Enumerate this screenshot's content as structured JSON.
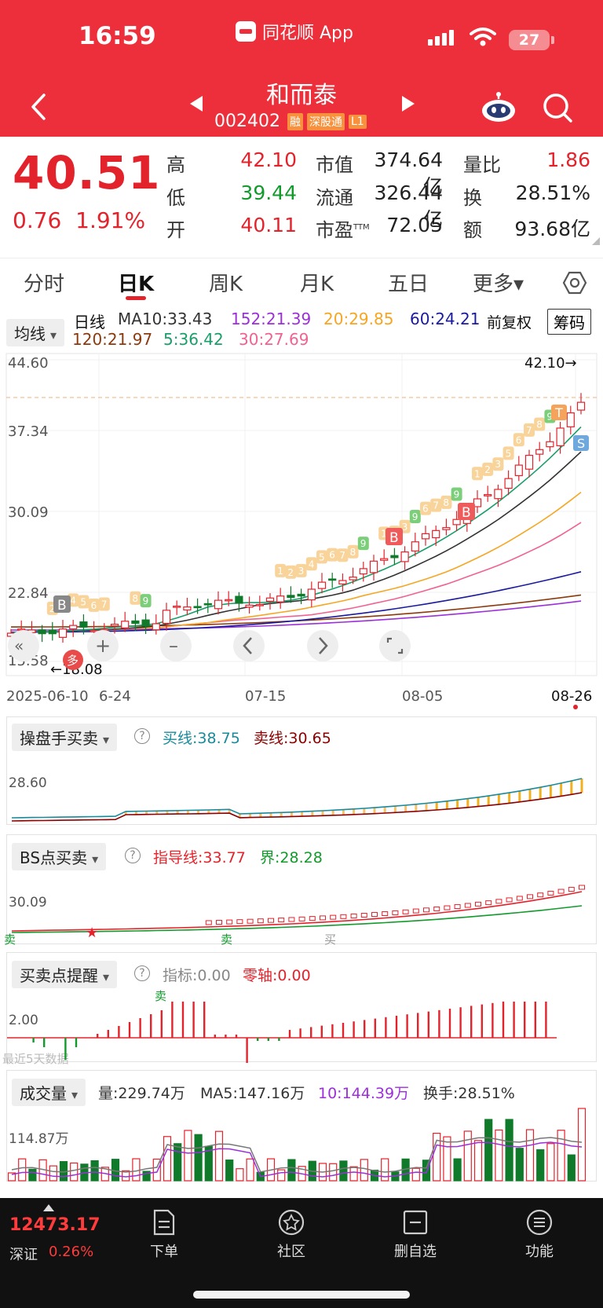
{
  "status_bar": {
    "time": "16:59",
    "app": "同花顺 App",
    "battery": "27"
  },
  "header": {
    "stock_name": "和而泰",
    "stock_code": "002402",
    "tags": [
      "融",
      "深股通",
      "L1"
    ]
  },
  "quote": {
    "price": "40.51",
    "change": "0.76",
    "change_pct": "1.91%",
    "fields": [
      {
        "label": "高",
        "value": "42.10"
      },
      {
        "label": "低",
        "value": "39.44"
      },
      {
        "label": "开",
        "value": "40.11"
      },
      {
        "label": "市值",
        "value": "374.64亿"
      },
      {
        "label": "流通",
        "value": "326.44亿"
      },
      {
        "label": "市盈",
        "sup": "TTM",
        "value": "72.05"
      },
      {
        "label": "量比",
        "value": "1.86"
      },
      {
        "label": "换",
        "value": "28.51%"
      },
      {
        "label": "额",
        "value": "93.68亿"
      }
    ]
  },
  "tabs": [
    "分时",
    "日K",
    "周K",
    "月K",
    "五日",
    "更多▾"
  ],
  "ma_legend": {
    "dropdown": "均线",
    "daily": "日线",
    "ma10": "MA10:33.43",
    "ma152": "152:21.39",
    "ma20": "20:29.85",
    "ma60": "60:24.21",
    "fq": "前复权",
    "chip": "筹码",
    "ma120": "120:21.97",
    "ma5": "5:36.42",
    "ma30": "30:27.69",
    "colors": {
      "ma10": "#333333",
      "ma152": "#9b30d9",
      "ma20": "#f5a623",
      "ma60": "#1a1a9e",
      "ma120": "#8b3a0e",
      "ma5": "#1a9e6a",
      "ma30": "#f06292"
    }
  },
  "kline": {
    "y_ticks": [
      "44.60",
      "37.34",
      "30.09",
      "22.84",
      "15.58"
    ],
    "x_ticks": [
      "2025-06-10",
      "6-24",
      "07-15",
      "08-05",
      "08-26"
    ],
    "high_label": "42.10→",
    "low_label": "←18.08",
    "signals": [
      "B",
      "B",
      "B",
      "T",
      "S",
      "多"
    ],
    "nums": [
      "1",
      "2",
      "3",
      "4",
      "5",
      "6",
      "7",
      "8",
      "9"
    ]
  },
  "panel1": {
    "title": "操盘手买卖",
    "buy": "买线:38.75",
    "sell": "卖线:30.65",
    "tick": "28.60"
  },
  "panel2": {
    "title": "BS点买卖",
    "guide": "指导线:33.77",
    "bound": "界:28.28",
    "tick": "30.09",
    "sell_mark": "卖",
    "buy_mark": "买"
  },
  "panel3": {
    "title": "买卖点提醒",
    "indicator": "指标:0.00",
    "zero": "零轴:0.00",
    "tick": "2.00",
    "note": "最近5天数据",
    "mark": "卖"
  },
  "panel4": {
    "title": "成交量",
    "vol": "量:229.74万",
    "ma5": "MA5:147.16万",
    "ma10": "10:144.39万",
    "turnover": "换手:28.51%",
    "tick": "114.87万"
  },
  "bottom_bar": {
    "index_value": "12473.17",
    "index_name": "深证",
    "index_pct": "0.26%",
    "items": [
      "下单",
      "社区",
      "删自选",
      "功能"
    ]
  }
}
